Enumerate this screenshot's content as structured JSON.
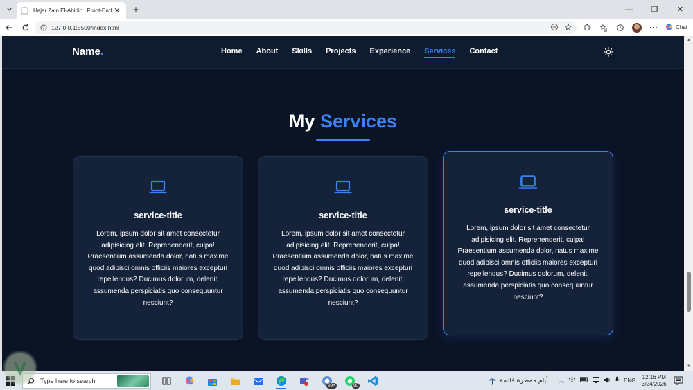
{
  "browser": {
    "tab_title": "Hajar Zain El-Abidin | Front-End De",
    "url": "127.0.0.1:5500/index.html",
    "chat_label": "Chat"
  },
  "site": {
    "logo_text": "Name",
    "logo_dot": ".",
    "nav": [
      {
        "label": "Home"
      },
      {
        "label": "About"
      },
      {
        "label": "Skills"
      },
      {
        "label": "Projects"
      },
      {
        "label": "Experience"
      },
      {
        "label": "Services",
        "active": true
      },
      {
        "label": "Contact"
      }
    ],
    "accent_color": "#3b82f6"
  },
  "services": {
    "title_plain": "My",
    "title_highlight": "Services",
    "cards": [
      {
        "title": "service-title",
        "description": "Lorem, ipsum dolor sit amet consectetur adipisicing elit. Reprehenderit, culpa! Praesentium assumenda dolor, natus maxime quod adipisci omnis officiis maiores excepturi repellendus? Ducimus dolorum, deleniti assumenda perspiciatis quo consequuntur nesciunt?",
        "icon": "laptop-icon"
      },
      {
        "title": "service-title",
        "description": "Lorem, ipsum dolor sit amet consectetur adipisicing elit. Reprehenderit, culpa! Praesentium assumenda dolor, natus maxime quod adipisci omnis officiis maiores excepturi repellendus? Ducimus dolorum, deleniti assumenda perspiciatis quo consequuntur nesciunt?",
        "icon": "laptop-icon"
      },
      {
        "title": "service-title",
        "description": "Lorem, ipsum dolor sit amet consectetur adipisicing elit. Reprehenderit, culpa! Praesentium assumenda dolor, natus maxime quod adipisci omnis officiis maiores excepturi repellendus? Ducimus dolorum, deleniti assumenda perspiciatis quo consequuntur nesciunt?",
        "icon": "laptop-icon"
      }
    ]
  },
  "taskbar": {
    "search_placeholder": "Type here to search",
    "weather_text": "أيام ممطرة قادمة",
    "language": "ENG",
    "time": "12:16 PM",
    "date": "3/24/2026",
    "badge_edge": "99+",
    "badge_whatsapp": "90"
  }
}
